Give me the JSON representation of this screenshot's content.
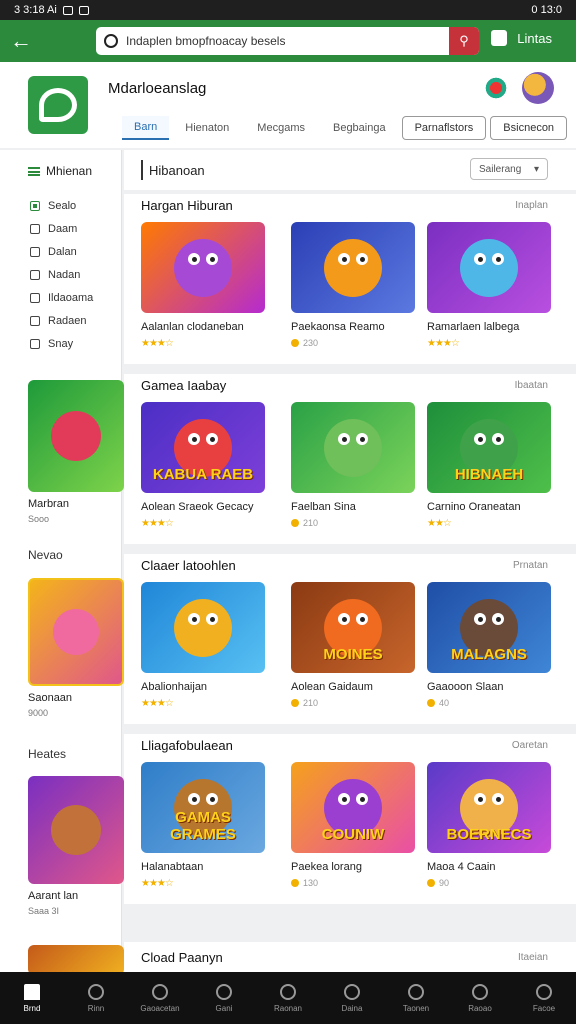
{
  "status": {
    "time": "3 3:18 Ai",
    "right": "0 13:0"
  },
  "topbar": {
    "search_text": "Indaplen bmopfnoacay besels",
    "action_label": "Lintas"
  },
  "header": {
    "title": "Mdarloeanslag"
  },
  "tabs": [
    {
      "label": "Barn",
      "style": "active"
    },
    {
      "label": "Hienaton",
      "style": ""
    },
    {
      "label": "Mecgams",
      "style": ""
    },
    {
      "label": "Begbainga",
      "style": ""
    },
    {
      "label": "Parnaflstors",
      "style": "boxed"
    },
    {
      "label": "Bsicnecon",
      "style": "boxed"
    }
  ],
  "sidebar": {
    "heading": "Mhienan",
    "items": [
      {
        "label": "Sealo",
        "checked": true
      },
      {
        "label": "Daam",
        "checked": false
      },
      {
        "label": "Dalan",
        "checked": false
      },
      {
        "label": "Nadan",
        "checked": false
      },
      {
        "label": "Ildaoama",
        "checked": false
      },
      {
        "label": "Radaen",
        "checked": false
      },
      {
        "label": "Snay",
        "checked": false
      }
    ],
    "card1": {
      "name": "Marbran",
      "sub": "Sooo"
    },
    "label2": "Nevao",
    "card2": {
      "name": "Saonaan",
      "sub": "9000"
    },
    "label3": "Heates",
    "card3": {
      "name": "Aarant lan",
      "sub": "Saaa 3I"
    }
  },
  "filter": {
    "chip": "Hibanoan",
    "sort_label": "Sailerang"
  },
  "sections": [
    {
      "title": "Hargan Hiburan",
      "more": "Inaplan",
      "games": [
        {
          "name": "Aalanlan clodaneban",
          "rating": "★★★☆",
          "meta": "",
          "bg": "linear-gradient(135deg,#ff7a00,#b52bd0)",
          "face": "#a64ad6"
        },
        {
          "name": "Paekaonsa Reamo",
          "rating": "",
          "meta": "230",
          "bg": "linear-gradient(135deg,#2b3fb5,#5b79e0)",
          "face": "#f39a1a"
        },
        {
          "name": "Ramarlaen lalbega",
          "rating": "★★★☆",
          "meta": "",
          "bg": "linear-gradient(135deg,#7a2fc1,#b94fe0)",
          "face": "#4fb6e8"
        }
      ]
    },
    {
      "title": "Gamea Iaabay",
      "more": "Ibaatan",
      "games": [
        {
          "name": "Aolean Sraeok Gecacy",
          "rating": "★★★☆",
          "meta": "",
          "bg": "linear-gradient(135deg,#4b2fc5,#7e3fd9)",
          "face": "#e84040",
          "banner": "KABUA RAEB"
        },
        {
          "name": "Faelban Sina",
          "rating": "",
          "meta": "210",
          "bg": "linear-gradient(135deg,#2aa146,#7bd35a)",
          "face": "#6fbf5a"
        },
        {
          "name": "Carnino Oraneatan",
          "rating": "★★☆",
          "meta": "",
          "bg": "linear-gradient(135deg,#1e8f3b,#4fbf4a)",
          "face": "#3fa24a",
          "banner": "HIBNAEH"
        }
      ]
    },
    {
      "title": "Claaer latoohlen",
      "more": "Prnatan",
      "games": [
        {
          "name": "Abalionhaijan",
          "rating": "★★★☆",
          "meta": "",
          "bg": "linear-gradient(135deg,#1f86d8,#58c0f2)",
          "face": "#f0b020"
        },
        {
          "name": "Aolean Gaidaum",
          "rating": "",
          "meta": "210",
          "bg": "linear-gradient(135deg,#8b3a13,#c7652b)",
          "face": "#f06a1f",
          "banner": "MOINES"
        },
        {
          "name": "Gaaooon Slaan",
          "rating": "",
          "meta": "40",
          "bg": "linear-gradient(135deg,#1f4ea6,#3f86d6)",
          "face": "#6a4a38",
          "banner": "MALAGNS"
        }
      ]
    },
    {
      "title": "Lliagafobulaean",
      "more": "Oaretan",
      "games": [
        {
          "name": "Halanabtaan",
          "rating": "★★★☆",
          "meta": "",
          "bg": "linear-gradient(135deg,#2f7dc8,#6aa8e0)",
          "face": "#b6762e",
          "banner": "GAMAS GRAMES"
        },
        {
          "name": "Paekea lorang",
          "rating": "",
          "meta": "130",
          "bg": "linear-gradient(135deg,#f5a11c,#e94fa6)",
          "face": "#9b3fd0",
          "banner": "COUNIW"
        },
        {
          "name": "Maoa 4 Caain",
          "rating": "",
          "meta": "90",
          "bg": "linear-gradient(135deg,#5a3ac8,#c84ad9)",
          "face": "#f0b14a",
          "banner": "BOERNECS"
        }
      ]
    }
  ],
  "last_section": {
    "title": "Cload Paanyn",
    "more": "Itaeian"
  },
  "bottom_nav": [
    {
      "label": "Brnd",
      "active": true
    },
    {
      "label": "Rinn",
      "active": false
    },
    {
      "label": "Gaoacetan",
      "active": false
    },
    {
      "label": "Gani",
      "active": false
    },
    {
      "label": "Raonan",
      "active": false
    },
    {
      "label": "Daina",
      "active": false
    },
    {
      "label": "Taonen",
      "active": false
    },
    {
      "label": "Raoao",
      "active": false
    },
    {
      "label": "Facoe",
      "active": false
    }
  ]
}
